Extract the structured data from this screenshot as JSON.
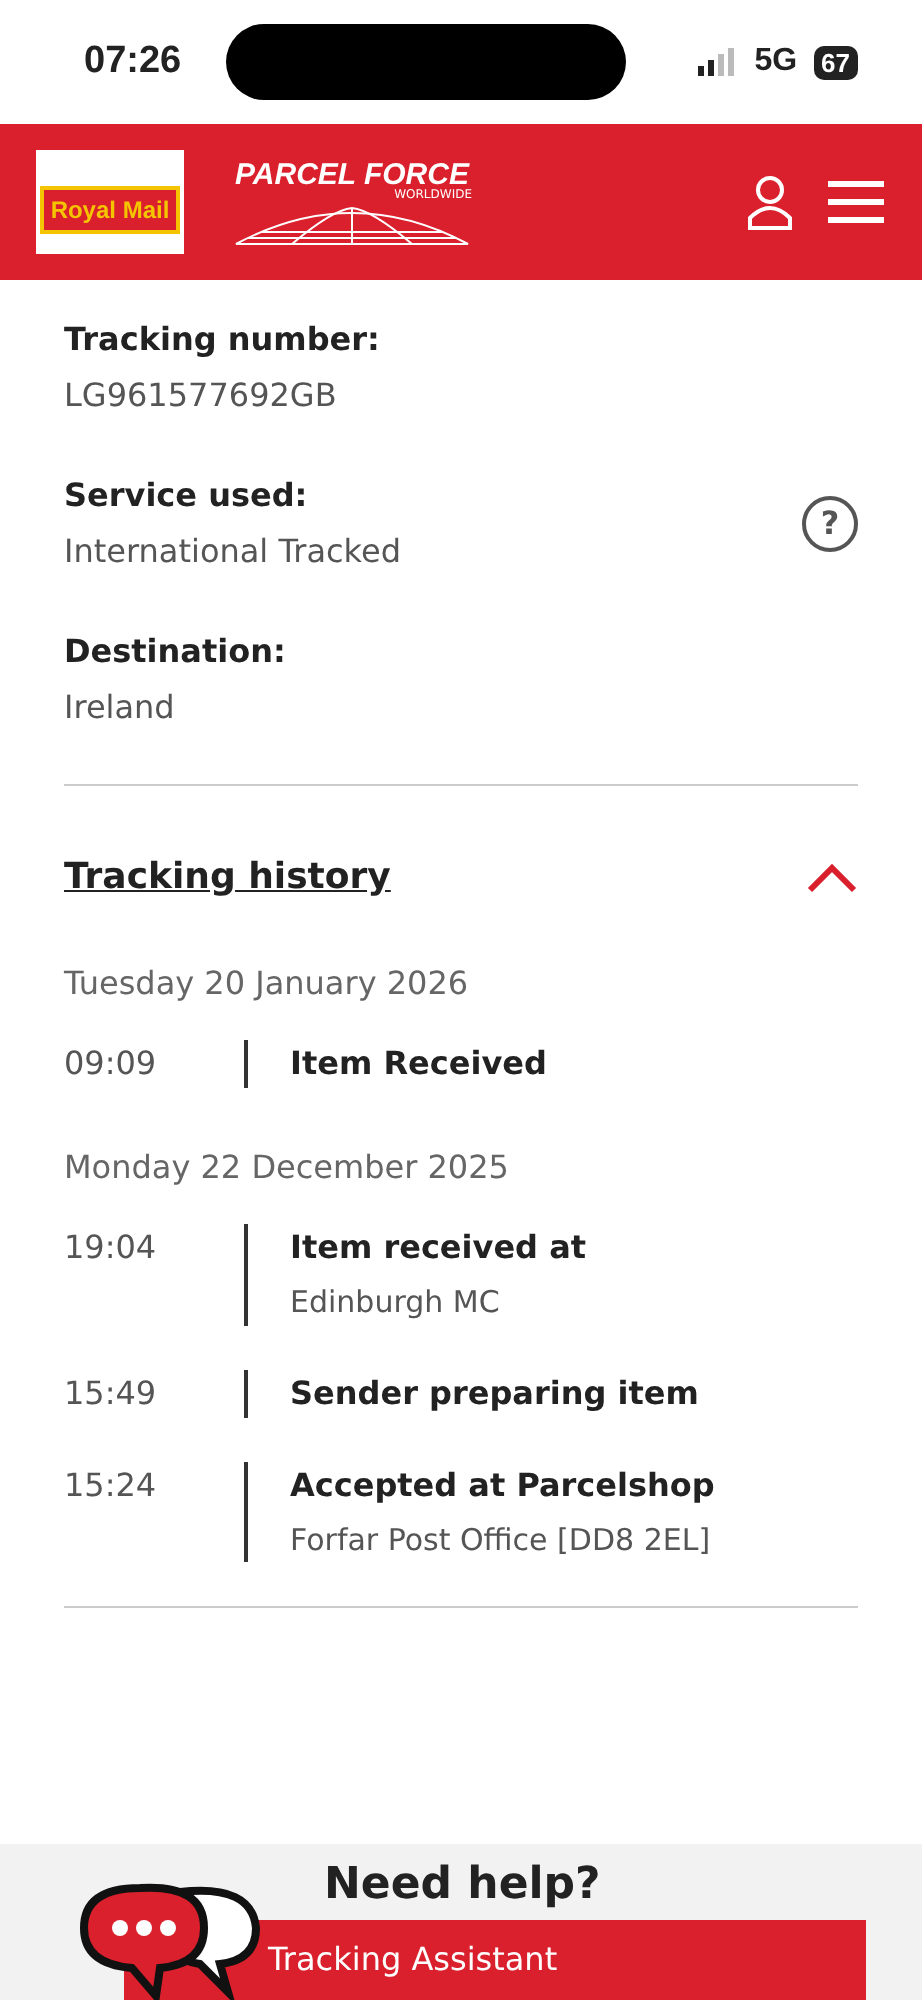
{
  "status_bar": {
    "time": "07:26",
    "network": "5G",
    "battery": "67"
  },
  "header": {
    "royal_mail_logo": "Royal Mail",
    "parcelforce_logo": "PARCEL FORCE",
    "parcelforce_sub": "WORLDWIDE"
  },
  "details": [
    {
      "label": "Tracking number:",
      "value": "LG961577692GB"
    },
    {
      "label": "Service used:",
      "value": "International Tracked",
      "help_icon": "?"
    },
    {
      "label": "Destination:",
      "value": "Ireland"
    }
  ],
  "tracking_history": {
    "title": "Tracking history",
    "expanded": true,
    "days": [
      {
        "date": "Tuesday 20 January 2026",
        "events": [
          {
            "time": "09:09",
            "status": "Item Received"
          }
        ]
      },
      {
        "date": "Monday 22 December 2025",
        "events": [
          {
            "time": "19:04",
            "status": "Item received at",
            "location": "Edinburgh MC"
          },
          {
            "time": "15:49",
            "status": "Sender preparing item"
          },
          {
            "time": "15:24",
            "status": "Accepted at Parcelshop",
            "location": "Forfar Post Office [DD8 2EL]"
          }
        ]
      }
    ]
  },
  "help": {
    "title": "Need help?",
    "assistant": "Tracking Assistant"
  }
}
